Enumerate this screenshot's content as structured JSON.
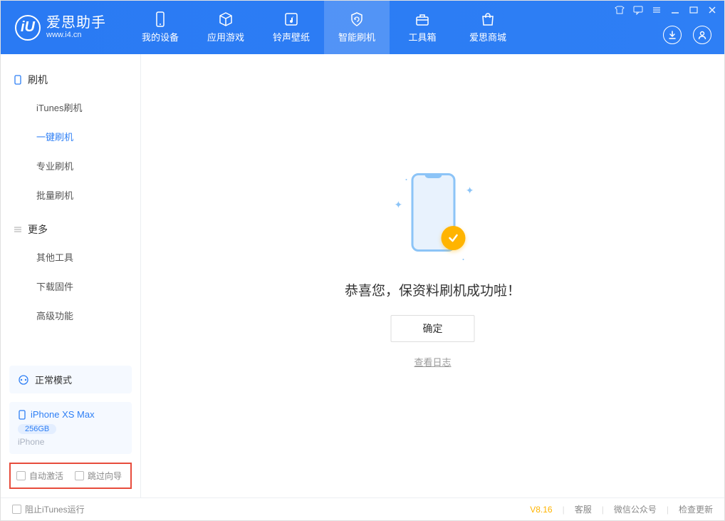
{
  "colors": {
    "accent": "#2e7ff5",
    "warning": "#ffb400",
    "highlight_border": "#e74c3c"
  },
  "logo": {
    "name": "爱思助手",
    "url": "www.i4.cn",
    "glyph": "iU"
  },
  "nav": [
    {
      "label": "我的设备",
      "icon": "device-icon"
    },
    {
      "label": "应用游戏",
      "icon": "cube-icon"
    },
    {
      "label": "铃声壁纸",
      "icon": "music-note-icon"
    },
    {
      "label": "智能刷机",
      "icon": "shield-refresh-icon",
      "active": true
    },
    {
      "label": "工具箱",
      "icon": "toolbox-icon"
    },
    {
      "label": "爱思商城",
      "icon": "store-icon"
    }
  ],
  "titlebar_icons": [
    "skin-icon",
    "feedback-icon",
    "menu-icon",
    "minimize-icon",
    "maximize-icon",
    "close-icon"
  ],
  "header_right": [
    "download-icon",
    "user-icon"
  ],
  "sidebar": {
    "groups": [
      {
        "title": "刷机",
        "icon": "phone-icon",
        "items": [
          {
            "label": "iTunes刷机"
          },
          {
            "label": "一键刷机",
            "active": true
          },
          {
            "label": "专业刷机"
          },
          {
            "label": "批量刷机"
          }
        ]
      },
      {
        "title": "更多",
        "icon": "list-icon",
        "items": [
          {
            "label": "其他工具"
          },
          {
            "label": "下载固件"
          },
          {
            "label": "高级功能"
          }
        ]
      }
    ],
    "mode_card": {
      "icon": "sync-icon",
      "label": "正常模式"
    },
    "device": {
      "name": "iPhone XS Max",
      "storage": "256GB",
      "type": "iPhone"
    },
    "options": [
      {
        "label": "自动激活",
        "checked": false
      },
      {
        "label": "跳过向导",
        "checked": false
      }
    ]
  },
  "main": {
    "success_text": "恭喜您，保资料刷机成功啦！",
    "ok_button": "确定",
    "log_link": "查看日志"
  },
  "footer": {
    "block_itunes": {
      "label": "阻止iTunes运行",
      "checked": false
    },
    "version": "V8.16",
    "links": [
      "客服",
      "微信公众号",
      "检查更新"
    ]
  }
}
